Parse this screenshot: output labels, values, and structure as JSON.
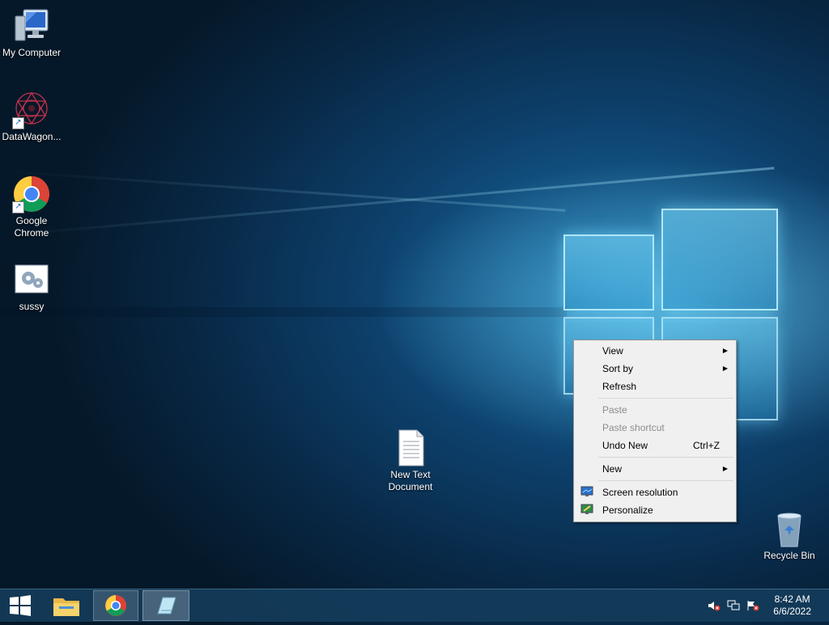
{
  "desktop": {
    "icons": [
      {
        "label": "My Computer",
        "icon": "computer-icon"
      },
      {
        "label": "DataWagon...",
        "icon": "datawagon-icon"
      },
      {
        "label": "Google Chrome",
        "icon": "chrome-icon"
      },
      {
        "label": "sussy",
        "icon": "settings-document-icon"
      },
      {
        "label": "New Text Document",
        "icon": "text-document-icon"
      },
      {
        "label": "Recycle Bin",
        "icon": "recycle-bin-icon"
      }
    ]
  },
  "context_menu": {
    "view": "View",
    "sort_by": "Sort by",
    "refresh": "Refresh",
    "paste": "Paste",
    "paste_shortcut": "Paste shortcut",
    "undo_new": "Undo New",
    "undo_new_key": "Ctrl+Z",
    "new": "New",
    "screen_resolution": "Screen resolution",
    "personalize": "Personalize",
    "submenu_arrow": "▶"
  },
  "taskbar": {
    "start_icon": "windows-logo-icon",
    "pinned": [
      "file-explorer-icon",
      "chrome-icon",
      "notepad-icon"
    ],
    "tray": [
      "volume-muted-icon",
      "network-icon",
      "action-center-icon"
    ],
    "time": "8:42 AM",
    "date": "6/6/2022"
  },
  "colors": {
    "accent": "#1a6fa6",
    "menu_bg": "#f0f0f0",
    "taskbar": "#143c5a"
  }
}
